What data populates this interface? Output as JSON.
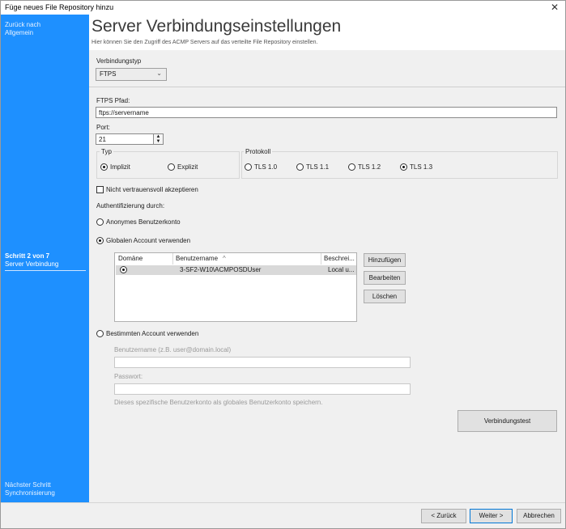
{
  "window": {
    "title": "Füge neues File Repository hinzu",
    "close": "✕"
  },
  "sidebar": {
    "back_line1": "Zurück nach",
    "back_line2": "Allgemein",
    "step_line1": "Schritt 2 von 7",
    "step_line2": "Server Verbindung",
    "next_line1": "Nächster Schritt",
    "next_line2": "Synchronisierung"
  },
  "header": {
    "title": "Server Verbindungseinstellungen",
    "subtitle": "Hier können Sie den Zugriff des ACMP Servers auf das verteilte File Repository einstellen."
  },
  "connection_type": {
    "label": "Verbindungstyp",
    "value": "FTPS"
  },
  "ftps_path": {
    "label": "FTPS Pfad:",
    "value": "ftps://servername"
  },
  "port": {
    "label": "Port:",
    "value": "21"
  },
  "type_group": {
    "label": "Typ",
    "options": [
      {
        "label": "Implizit",
        "selected": true
      },
      {
        "label": "Explizit",
        "selected": false
      }
    ]
  },
  "protocol_group": {
    "label": "Protokoll",
    "options": [
      {
        "label": "TLS 1.0",
        "selected": false
      },
      {
        "label": "TLS 1.1",
        "selected": false
      },
      {
        "label": "TLS 1.2",
        "selected": false
      },
      {
        "label": "TLS 1.3",
        "selected": true
      }
    ]
  },
  "untrusted_checkbox": {
    "label": "Nicht vertrauensvoll akzeptieren",
    "checked": false
  },
  "auth": {
    "label": "Authentifizierung durch:",
    "anonymous": "Anonymes Benutzerkonto",
    "global": "Globalen Account verwenden",
    "specific": "Bestimmten Account verwenden",
    "selected": "global"
  },
  "accounts_table": {
    "columns": [
      "Domäne",
      "Benutzername",
      "Beschrei..."
    ],
    "sort_indicator": "^",
    "rows": [
      {
        "domain": "",
        "username": "3-SF2-W10\\ACMPOSDUser",
        "description": "Local u...",
        "selected": true
      }
    ]
  },
  "table_buttons": {
    "add": "Hinzufügen",
    "edit": "Bearbeiten",
    "delete": "Löschen"
  },
  "specific_account": {
    "username_label": "Benutzername (z.B. user@domain.local)",
    "username_value": "",
    "password_label": "Passwort:",
    "password_value": "",
    "note": "Dieses spezifische Benutzerkonto als globales Benutzerkonto speichern."
  },
  "connection_test": {
    "label": "Verbindungstest"
  },
  "footer": {
    "back": "< Zurück",
    "next": "Weiter >",
    "cancel": "Abbrechen"
  }
}
